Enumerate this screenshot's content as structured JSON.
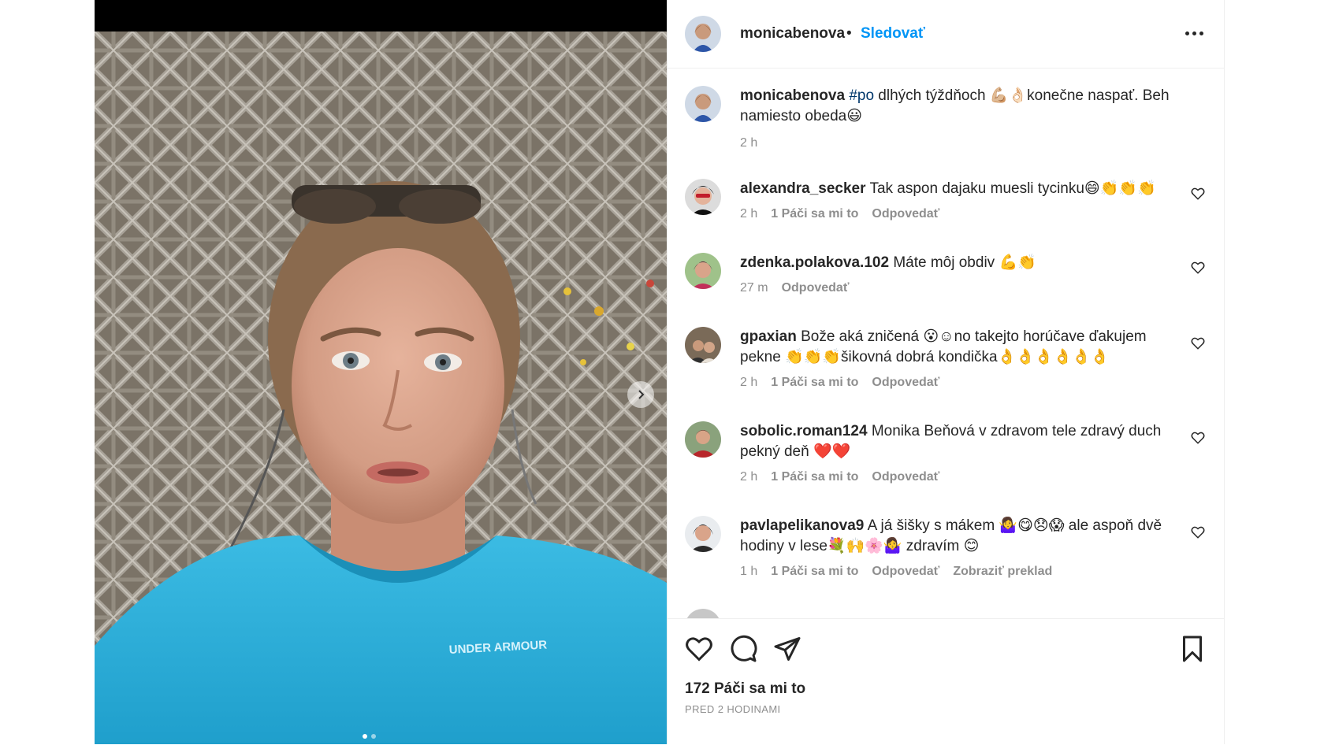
{
  "post": {
    "author": "monicabenova",
    "follow_label": "Sledovať",
    "bullet": "•",
    "caption": {
      "hashtag": "#po",
      "text": " dlhých týždňoch 💪🏼👌🏻konečne naspať. Beh namiesto obeda😃",
      "time": "2 h"
    },
    "image": {
      "shirt_brand": "UNDER ARMOUR"
    },
    "carousel": {
      "total": 2,
      "current": 1
    }
  },
  "comments": [
    {
      "user": "alexandra_secker",
      "text": "Tak aspon dajaku muesli tycinku😄👏👏👏",
      "time": "2 h",
      "likes": "1 Páči sa mi to",
      "reply": "Odpovedať",
      "translate": ""
    },
    {
      "user": "zdenka.polakova.102",
      "text": "Máte môj obdiv 💪👏",
      "time": "27 m",
      "likes": "",
      "reply": "Odpovedať",
      "translate": ""
    },
    {
      "user": "gpaxian",
      "text": "Bože aká zničená 😮☺no takejto horúčave ďakujem pekne 👏👏👏šikovná dobrá kondička👌👌👌👌👌👌",
      "time": "2 h",
      "likes": "1 Páči sa mi to",
      "reply": "Odpovedať",
      "translate": ""
    },
    {
      "user": "sobolic.roman124",
      "text": "Monika Beňová v zdravom tele zdravý duch pekný deň ❤️❤️",
      "time": "2 h",
      "likes": "1 Páči sa mi to",
      "reply": "Odpovedať",
      "translate": ""
    },
    {
      "user": "pavlapelikanova9",
      "text": "A já šišky s mákem 🤷‍♀️😋😞😱 ale aspoň dvě hodiny v lese💐🙌🌸🤷‍♀️ zdravím 😊",
      "time": "1 h",
      "likes": "1 Páči sa mi to",
      "reply": "Odpovedať",
      "translate": "Zobraziť preklad"
    }
  ],
  "footer": {
    "likes": "172 Páči sa mi to",
    "timestamp": "PRED 2 HODINAMI"
  },
  "colors": {
    "link_blue": "#0095f6",
    "hashtag_blue": "#00376b",
    "muted": "#8e8e8e",
    "text": "#262626",
    "shirt": "#2fb1dd"
  },
  "icons": [
    "chevron-right-icon",
    "more-icon",
    "heart-icon",
    "comment-icon",
    "share-icon",
    "bookmark-icon"
  ]
}
